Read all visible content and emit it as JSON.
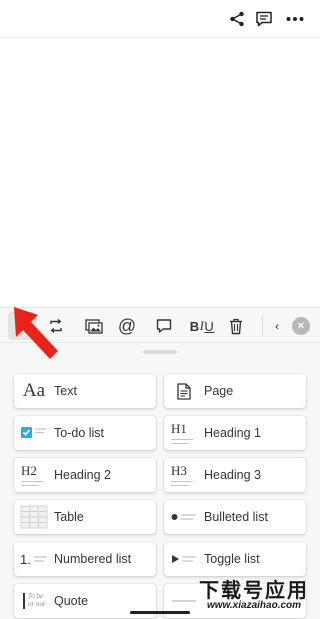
{
  "topbar": {
    "icons": [
      "share-icon",
      "comment-icon",
      "more-icon"
    ]
  },
  "toolbar": {
    "icons": [
      "plus-icon",
      "turn-into-icon",
      "media-icon",
      "mention-icon",
      "comment-icon",
      "text-format-icon",
      "trash-icon",
      "back-icon",
      "close-icon"
    ],
    "plus": "+",
    "mention": "@",
    "format_bold": "B",
    "format_italic": "I",
    "format_underline": "U",
    "back": "‹",
    "close": "×"
  },
  "blocks": [
    {
      "label": "Text",
      "icon": "text-aa-icon",
      "glyph": "Aa"
    },
    {
      "label": "Page",
      "icon": "page-icon"
    },
    {
      "label": "To-do list",
      "icon": "todo-checkbox-icon"
    },
    {
      "label": "Heading 1",
      "icon": "heading-1-icon",
      "glyph": "H1"
    },
    {
      "label": "Heading 2",
      "icon": "heading-2-icon",
      "glyph": "H2"
    },
    {
      "label": "Heading 3",
      "icon": "heading-3-icon",
      "glyph": "H3"
    },
    {
      "label": "Table",
      "icon": "table-icon"
    },
    {
      "label": "Bulleted list",
      "icon": "bulleted-list-icon"
    },
    {
      "label": "Numbered list",
      "icon": "numbered-list-icon",
      "glyph": "1."
    },
    {
      "label": "Toggle list",
      "icon": "toggle-list-icon"
    },
    {
      "label": "Quote",
      "icon": "quote-icon",
      "glyph_line1": "To be",
      "glyph_line2": "or not"
    },
    {
      "label": "Divider",
      "icon": "divider-icon"
    }
  ],
  "watermark": {
    "text": "下载号应用",
    "url": "www.xiazaihao.com"
  },
  "colors": {
    "accent_checkbox": "#2eaadc",
    "arrow": "#e8231b",
    "sheet_bg": "#f7f7f5",
    "text": "#37352f"
  }
}
